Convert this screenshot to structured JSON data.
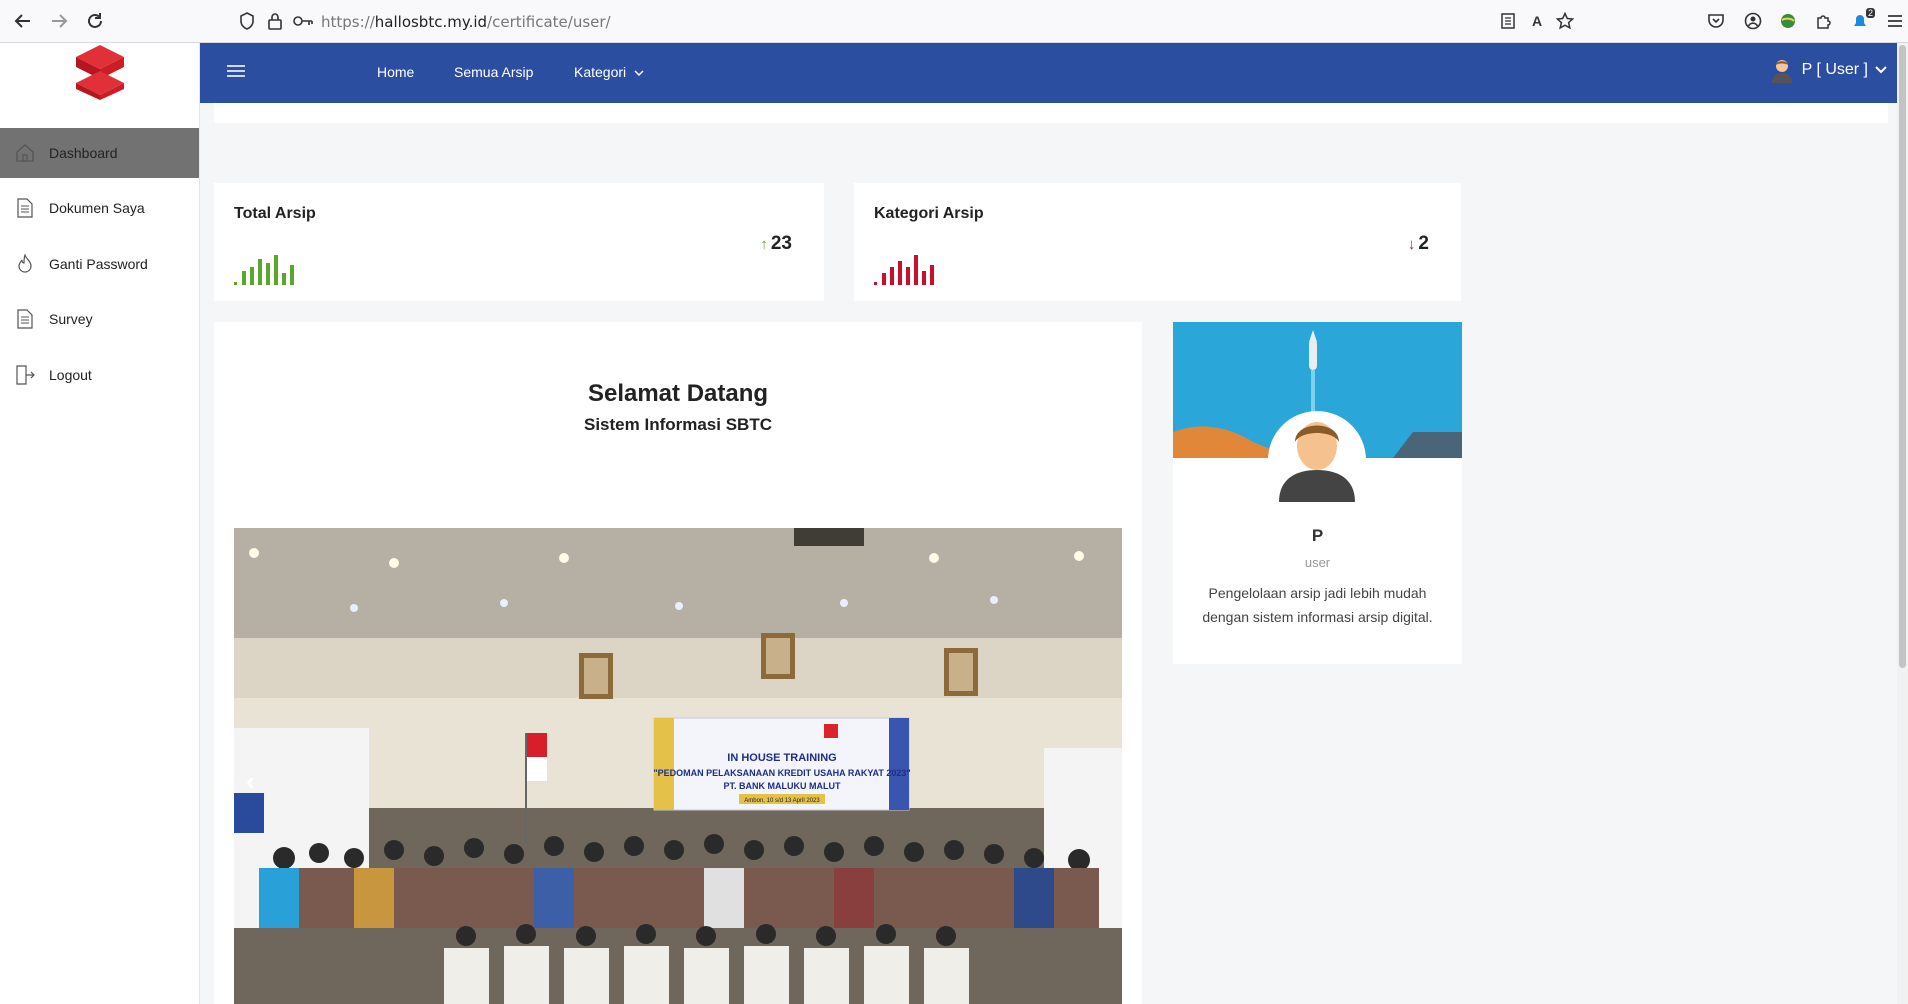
{
  "browser": {
    "url_prefix": "https://",
    "url_host": "hallosbtc.my.id",
    "url_path": "/certificate/user/",
    "extensions_badge": "2"
  },
  "sidebar": {
    "items": [
      {
        "label": "Dashboard",
        "icon": "home-icon"
      },
      {
        "label": "Dokumen Saya",
        "icon": "document-icon"
      },
      {
        "label": "Ganti Password",
        "icon": "fire-icon"
      },
      {
        "label": "Survey",
        "icon": "document-icon"
      },
      {
        "label": "Logout",
        "icon": "logout-icon"
      }
    ]
  },
  "topnav": {
    "links": [
      "Home",
      "Semua Arsip",
      "Kategori"
    ],
    "user_label": "P [ User ]"
  },
  "stats": {
    "total": {
      "title": "Total Arsip",
      "value": "23",
      "trend": "up",
      "color": "#5aa82b"
    },
    "kategori": {
      "title": "Kategori Arsip",
      "value": "2",
      "trend": "down",
      "color": "#c8102e"
    }
  },
  "welcome": {
    "title": "Selamat Datang",
    "subtitle": "Sistem Informasi SBTC",
    "banner": {
      "line1": "IN HOUSE TRAINING",
      "line2": "\"PEDOMAN PELAKSANAAN KREDIT USAHA RAKYAT 2023\"",
      "line3": "PT. BANK MALUKU MALUT",
      "line4": "Ambon, 10 s/d 13 April 2023"
    }
  },
  "profile": {
    "name": "P",
    "role": "user",
    "description": "Pengelolaan arsip jadi lebih mudah dengan sistem informasi arsip digital."
  },
  "colors": {
    "navbar": "#2c4ea0",
    "sidebar_active": "#727272",
    "brand_red": "#d9242b"
  }
}
